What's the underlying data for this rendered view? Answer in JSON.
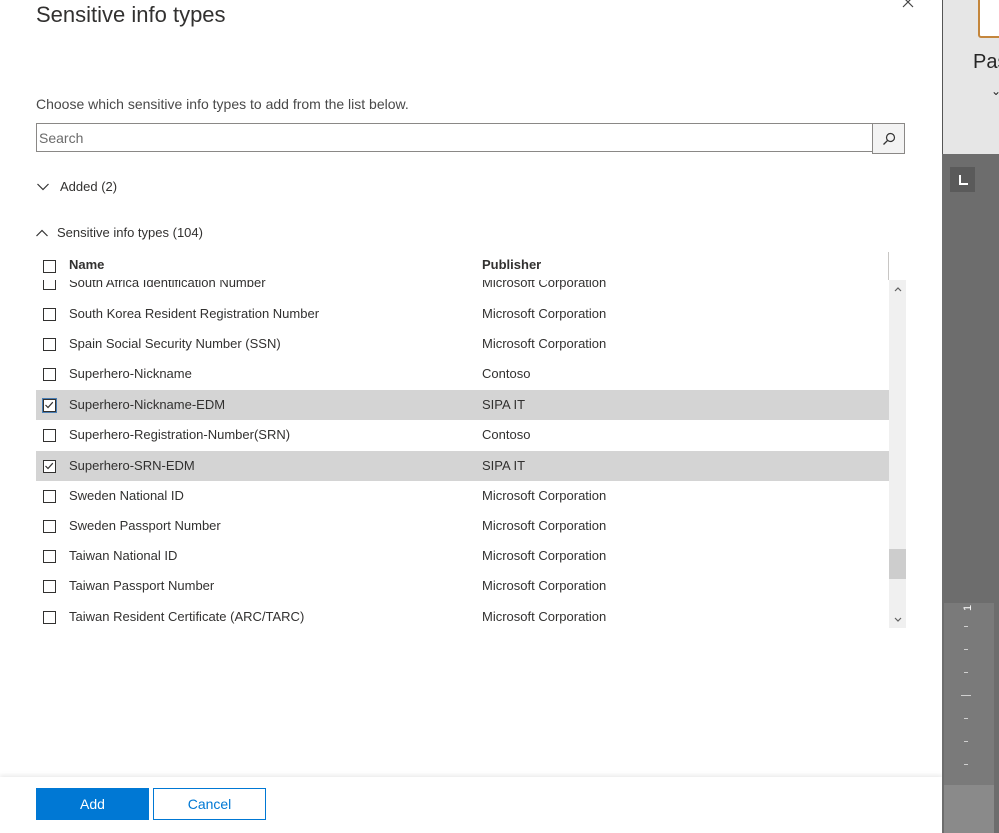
{
  "dialog": {
    "title": "Sensitive info types",
    "description": "Choose which sensitive info types to add from the list below.",
    "search": {
      "placeholder": "Search",
      "value": ""
    },
    "sections": {
      "added": {
        "label": "Added (2)",
        "expanded": false
      },
      "types": {
        "label": "Sensitive info types (104)",
        "expanded": true
      }
    },
    "table": {
      "columns": {
        "name": "Name",
        "publisher": "Publisher"
      },
      "rows": [
        {
          "name": "South Africa Identification Number",
          "publisher": "Microsoft Corporation",
          "checked": false,
          "selected": false
        },
        {
          "name": "South Korea Resident Registration Number",
          "publisher": "Microsoft Corporation",
          "checked": false,
          "selected": false
        },
        {
          "name": "Spain Social Security Number (SSN)",
          "publisher": "Microsoft Corporation",
          "checked": false,
          "selected": false
        },
        {
          "name": "Superhero-Nickname",
          "publisher": "Contoso",
          "checked": false,
          "selected": false
        },
        {
          "name": "Superhero-Nickname-EDM",
          "publisher": "SIPA IT",
          "checked": true,
          "selected": true
        },
        {
          "name": "Superhero-Registration-Number(SRN)",
          "publisher": "Contoso",
          "checked": false,
          "selected": false
        },
        {
          "name": "Superhero-SRN-EDM",
          "publisher": "SIPA IT",
          "checked": true,
          "selected": true
        },
        {
          "name": "Sweden National ID",
          "publisher": "Microsoft Corporation",
          "checked": false,
          "selected": false
        },
        {
          "name": "Sweden Passport Number",
          "publisher": "Microsoft Corporation",
          "checked": false,
          "selected": false
        },
        {
          "name": "Taiwan National ID",
          "publisher": "Microsoft Corporation",
          "checked": false,
          "selected": false
        },
        {
          "name": "Taiwan Passport Number",
          "publisher": "Microsoft Corporation",
          "checked": false,
          "selected": false
        },
        {
          "name": "Taiwan Resident Certificate (ARC/TARC)",
          "publisher": "Microsoft Corporation",
          "checked": false,
          "selected": false
        }
      ]
    },
    "footer": {
      "add_label": "Add",
      "cancel_label": "Cancel"
    }
  },
  "background_app": {
    "paste_label": "Pas",
    "ruler_number": "1"
  },
  "colors": {
    "primary": "#0078d4",
    "selected_row": "#d4d4d4"
  }
}
